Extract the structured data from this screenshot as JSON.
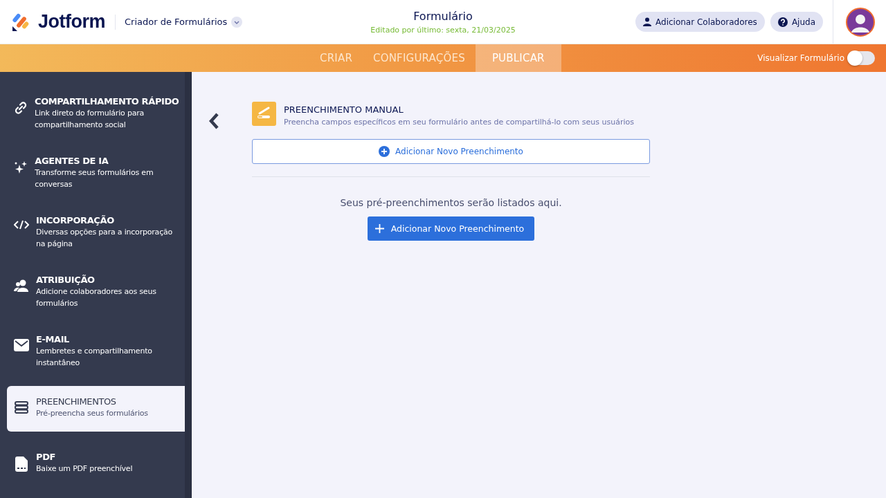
{
  "header": {
    "logo": "Jotform",
    "builder_menu": "Criador de Formulários",
    "title": "Formulário",
    "subtitle": "Editado por último: sexta, 21/03/2025",
    "buttons": [
      "Adicionar Colaboradores",
      "Ajuda"
    ]
  },
  "tabs": [
    {
      "label": "CRIAR",
      "selected": false
    },
    {
      "label": "CONFIGURAÇÕES",
      "selected": false
    },
    {
      "label": "PUBLICAR",
      "selected": true
    }
  ],
  "preview_toggle": {
    "label": "Visualizar Formulário",
    "on": false
  },
  "sidebar": {
    "items": [
      {
        "title": "COMPARTILHAMENTO RÁPIDO",
        "description": "Link direto do formulário para compartilhamento social",
        "selected": false
      },
      {
        "title": "AGENTES DE IA",
        "description": "Transforme seus formulários em conversas",
        "selected": false
      },
      {
        "title": "INCORPORAÇÃO",
        "description": "Diversas opções para a incorporação na página",
        "selected": false
      },
      {
        "title": "ATRIBUIÇÃO",
        "description": "Adicione colaboradores aos seus formulários",
        "selected": false
      },
      {
        "title": "E-MAIL",
        "description": "Lembretes e compartilhamento instantâneo",
        "selected": false
      },
      {
        "title": "PREENCHIMENTOS",
        "description": "Pré-preencha seus formulários",
        "selected": true
      },
      {
        "title": "PDF",
        "description": "Baixe um PDF preenchível",
        "selected": false
      }
    ]
  },
  "panel": {
    "title": "PREENCHIMENTO MANUAL",
    "description": "Preencha campos específicos em seu formulário antes de compartilhá-lo com seus usuários",
    "outline_button": "Adicionar Novo Preenchimento",
    "empty_message": "Seus pré-preenchimentos serão listados aqui.",
    "primary_button": "Adicionar Novo Preenchimento"
  }
}
